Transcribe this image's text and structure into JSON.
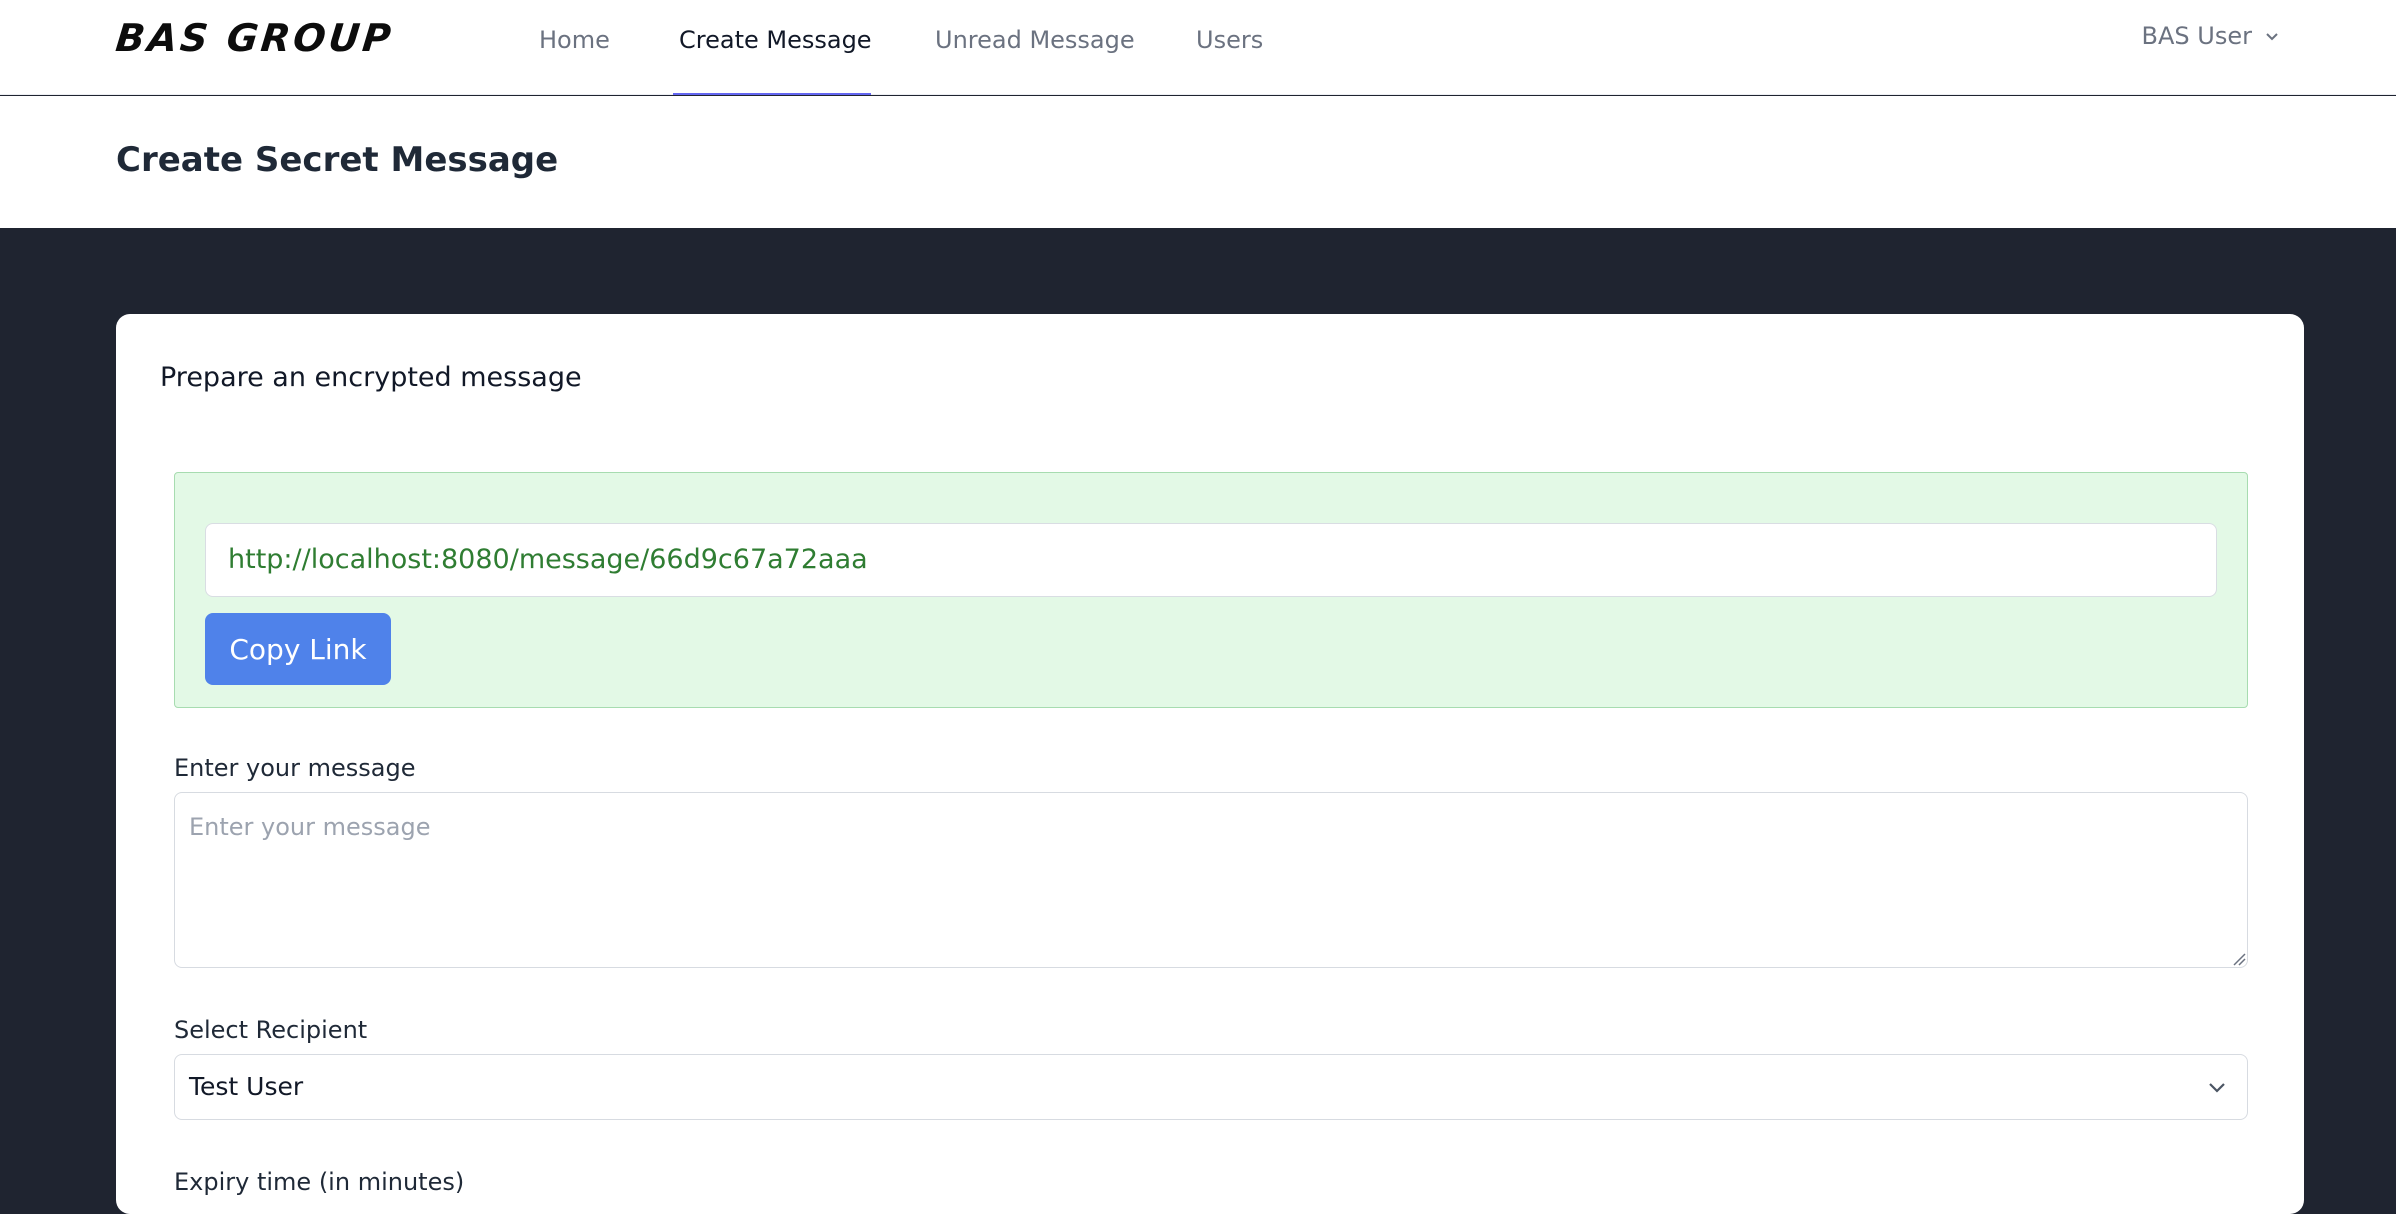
{
  "brand": {
    "logo_text": "BAS GROUP"
  },
  "nav": {
    "items": [
      {
        "label": "Home",
        "active": false
      },
      {
        "label": "Create Message",
        "active": true
      },
      {
        "label": "Unread Message",
        "active": false
      },
      {
        "label": "Users",
        "active": false
      }
    ],
    "user_label": "BAS User"
  },
  "header": {
    "title": "Create Secret Message"
  },
  "card": {
    "title": "Prepare an encrypted message",
    "link_value": "http://localhost:8080/message/66d9c67a72aaa",
    "copy_button": "Copy Link",
    "message_label": "Enter your message",
    "message_placeholder": "Enter your message",
    "recipient_label": "Select Recipient",
    "recipient_value": "Test User",
    "expiry_label": "Expiry time (in minutes)"
  },
  "colors": {
    "accent": "#4f82ea",
    "active_underline": "#6366f1",
    "success_bg": "#e3f9e6",
    "link_text": "#2f7d32",
    "page_bg": "#1f2430"
  }
}
